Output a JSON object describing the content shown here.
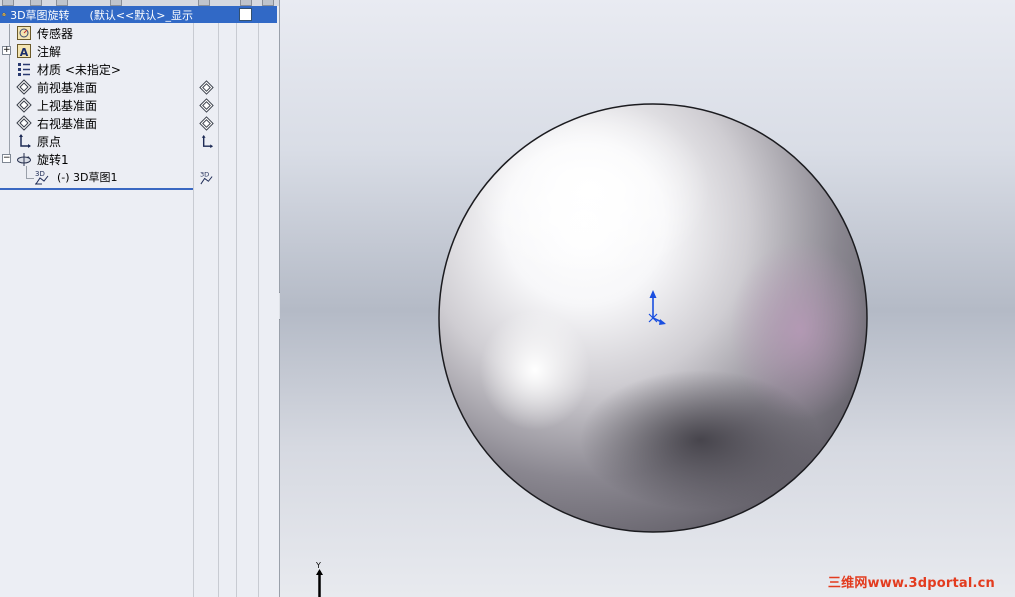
{
  "tree": {
    "header": {
      "part_name": "3D草图旋转",
      "config_text": "(默认<<默认>_显示"
    },
    "items": [
      {
        "id": "sensors",
        "label": "传感器",
        "icon": "sensor-icon"
      },
      {
        "id": "annotations",
        "label": "注解",
        "icon": "annotation-icon",
        "expander": "+"
      },
      {
        "id": "material",
        "label": "材质 <未指定>",
        "icon": "material-icon"
      },
      {
        "id": "front-plane",
        "label": "前视基准面",
        "icon": "plane-icon"
      },
      {
        "id": "top-plane",
        "label": "上视基准面",
        "icon": "plane-icon"
      },
      {
        "id": "right-plane",
        "label": "右视基准面",
        "icon": "plane-icon"
      },
      {
        "id": "origin",
        "label": "原点",
        "icon": "origin-icon"
      },
      {
        "id": "revolve1",
        "label": "旋转1",
        "icon": "revolve-icon",
        "expander": "−"
      },
      {
        "id": "sketch3d1",
        "label": "(-) 3D草图1",
        "icon": "sketch3d-icon"
      }
    ]
  },
  "viewport": {
    "axis_label": "Y",
    "watermark": "三维网www.3dportal.cn"
  },
  "colors": {
    "header_bg": "#3169c6",
    "tree_bg": "#eceef4",
    "triad_blue": "#1a4fe0",
    "watermark": "#e33b1f"
  }
}
